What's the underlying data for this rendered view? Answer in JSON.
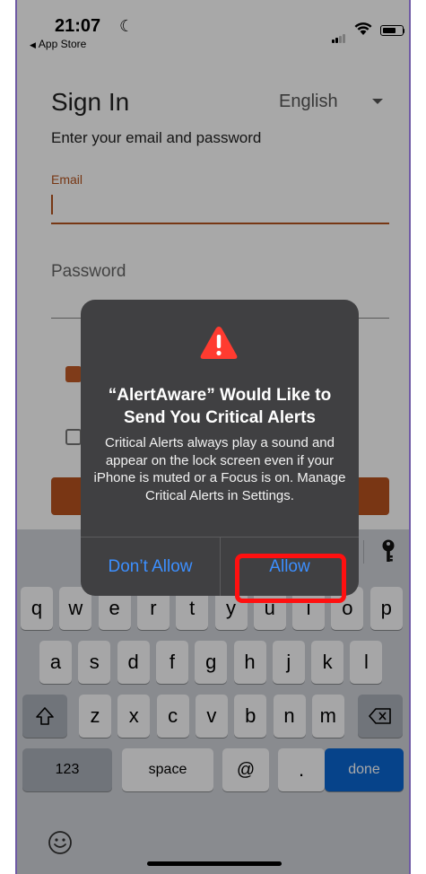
{
  "status_bar": {
    "time": "21:07",
    "back_label": "App Store",
    "battery_percent": 70
  },
  "signin": {
    "title": "Sign In",
    "language": "English",
    "subtitle": "Enter your email and password",
    "email_label": "Email",
    "email_value": "",
    "password_placeholder": "Password",
    "remember_checked": true,
    "second_checked": false
  },
  "alert": {
    "title": "“AlertAware” Would Like to Send You Critical Alerts",
    "message": "Critical Alerts always play a sound and appear on the lock screen even if your iPhone is muted or a Focus is on. Manage Critical Alerts in Settings.",
    "deny_label": "Don’t Allow",
    "allow_label": "Allow"
  },
  "keyboard": {
    "row1": [
      "q",
      "w",
      "e",
      "r",
      "t",
      "y",
      "u",
      "i",
      "o",
      "p"
    ],
    "row2": [
      "a",
      "s",
      "d",
      "f",
      "g",
      "h",
      "j",
      "k",
      "l"
    ],
    "row3": [
      "z",
      "x",
      "c",
      "v",
      "b",
      "n",
      "m"
    ],
    "numbers_label": "123",
    "space_label": "space",
    "at_label": "@",
    "dot_label": ".",
    "done_label": "done"
  },
  "colors": {
    "accent": "#b8531f",
    "alert_button": "#3c8fff",
    "highlight": "#ff1010",
    "done_key": "#0a66d2"
  }
}
